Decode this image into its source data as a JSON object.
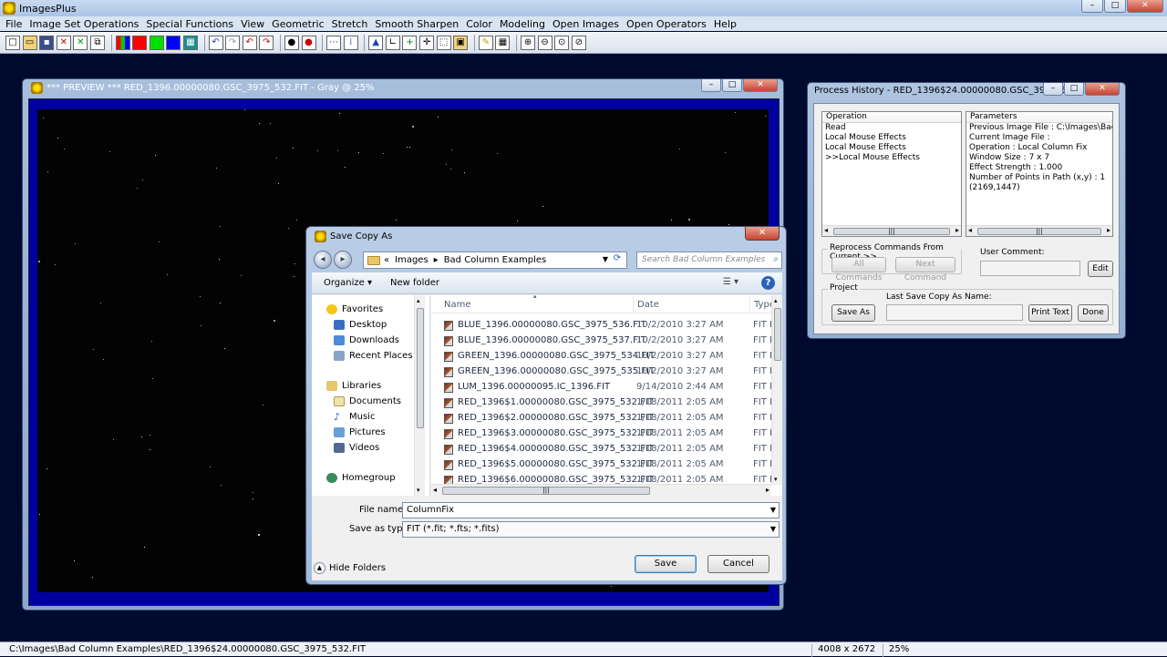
{
  "app": {
    "title": "ImagesPlus"
  },
  "menu": [
    "File",
    "Image Set Operations",
    "Special Functions",
    "View",
    "Geometric",
    "Stretch",
    "Smooth Sharpen",
    "Color",
    "Modeling",
    "Open Images",
    "Open Operators",
    "Help"
  ],
  "toolbar": {
    "buttons": [
      "new-file",
      "open-file",
      "save",
      "close",
      "cancel",
      "copy",
      "rgb",
      "red-channel",
      "green-channel",
      "blue-channel",
      "grid",
      "undo",
      "redo",
      "undo-all",
      "redo-all",
      "circle-white",
      "circle-red",
      "dots",
      "dots-vertical",
      "histogram",
      "axis",
      "crosshair",
      "plus",
      "selection",
      "image-info",
      "pencil",
      "grid-table",
      "zoom-in",
      "zoom-out",
      "zoom-fit",
      "zoom-actual"
    ],
    "colors": {
      "red": "#ff0000",
      "green": "#00e000",
      "blue": "#0000ff"
    }
  },
  "preview": {
    "title": "*** PREVIEW *** RED_1396.00000080.GSC_3975_532.FIT - Gray @ 25%"
  },
  "history": {
    "title": "Process History - RED_1396$24.00000080.GSC_3975_532....",
    "operation_header": "Operation",
    "operations": [
      "Read",
      "Local Mouse Effects",
      "Local Mouse Effects",
      ">>Local Mouse Effects"
    ],
    "parameters_header": "Parameters",
    "parameters": [
      "Previous Image File : C:\\Images\\Bad Co...",
      "Current Image File :",
      "Operation : Local Column Fix",
      "Window Size : 7 x 7",
      "Effect Strength : 1.000",
      "Number of Points in Path (x,y) : 1",
      "(2169,1447)"
    ],
    "reprocess_label": "Reprocess Commands From Current >>",
    "all_commands": "All Commands",
    "next_command": "Next Command",
    "user_comment_label": "User Comment:",
    "edit_button": "Edit",
    "project_label": "Project",
    "last_save_label": "Last Save Copy As Name:",
    "save_as_button": "Save As",
    "print_text_button": "Print Text",
    "done_button": "Done"
  },
  "dialog": {
    "title": "Save Copy As",
    "path": [
      "«",
      "Images",
      "Bad Column Examples"
    ],
    "search_placeholder": "Search Bad Column Examples",
    "organize": "Organize ▾",
    "new_folder": "New folder",
    "nav": {
      "favorites": "Favorites",
      "desktop": "Desktop",
      "downloads": "Downloads",
      "recent": "Recent Places",
      "libraries": "Libraries",
      "documents": "Documents",
      "music": "Music",
      "pictures": "Pictures",
      "videos": "Videos",
      "homegroup": "Homegroup"
    },
    "columns": {
      "name": "Name",
      "date": "Date",
      "type": "Type"
    },
    "files": [
      {
        "name": "BLUE_1396.00000080.GSC_3975_536.FIT",
        "date": "10/2/2010 3:27 AM",
        "type": "FIT Fi"
      },
      {
        "name": "BLUE_1396.00000080.GSC_3975_537.FIT",
        "date": "10/2/2010 3:27 AM",
        "type": "FIT Fi"
      },
      {
        "name": "GREEN_1396.00000080.GSC_3975_534.FIT",
        "date": "10/2/2010 3:27 AM",
        "type": "FIT Fi"
      },
      {
        "name": "GREEN_1396.00000080.GSC_3975_535.FIT",
        "date": "10/2/2010 3:27 AM",
        "type": "FIT Fi"
      },
      {
        "name": "LUM_1396.00000095.IC_1396.FIT",
        "date": "9/14/2010 2:44 AM",
        "type": "FIT Fi"
      },
      {
        "name": "RED_1396$1.00000080.GSC_3975_532.FIT",
        "date": "1/18/2011 2:05 AM",
        "type": "FIT Fi"
      },
      {
        "name": "RED_1396$2.00000080.GSC_3975_532.FIT",
        "date": "1/18/2011 2:05 AM",
        "type": "FIT Fi"
      },
      {
        "name": "RED_1396$3.00000080.GSC_3975_532.FIT",
        "date": "1/18/2011 2:05 AM",
        "type": "FIT Fi"
      },
      {
        "name": "RED_1396$4.00000080.GSC_3975_532.FIT",
        "date": "1/18/2011 2:05 AM",
        "type": "FIT Fi"
      },
      {
        "name": "RED_1396$5.00000080.GSC_3975_532.FIT",
        "date": "1/18/2011 2:05 AM",
        "type": "FIT Fi"
      },
      {
        "name": "RED_1396$6.00000080.GSC_3975_532.FIT",
        "date": "1/18/2011 2:05 AM",
        "type": "FIT Fi"
      }
    ],
    "file_name_label": "File name:",
    "file_name_value": "ColumnFix",
    "save_type_label": "Save as type:",
    "save_type_value": "FIT (*.fit; *.fts; *.fits)",
    "hide_folders": "Hide Folders",
    "save_button": "Save",
    "cancel_button": "Cancel"
  },
  "status": {
    "path": "C:\\Images\\Bad Column Examples\\RED_1396$24.00000080.GSC_3975_532.FIT",
    "dimensions": "4008 x 2672",
    "zoom": "25%"
  }
}
